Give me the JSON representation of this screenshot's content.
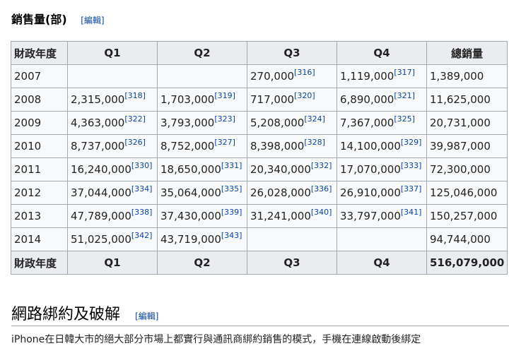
{
  "section_title": "銷售量(部)",
  "edit_label": "編輯",
  "table": {
    "headers": [
      "財政年度",
      "Q1",
      "Q2",
      "Q3",
      "Q4",
      "總銷量"
    ],
    "rows": [
      {
        "year": "2007",
        "q": [
          [
            "",
            ""
          ],
          [
            "",
            ""
          ],
          [
            "270,000",
            "[316]"
          ],
          [
            "1,119,000",
            "[317]"
          ]
        ],
        "total": "1,389,000"
      },
      {
        "year": "2008",
        "q": [
          [
            "2,315,000",
            "[318]"
          ],
          [
            "1,703,000",
            "[319]"
          ],
          [
            "717,000",
            "[320]"
          ],
          [
            "6,890,000",
            "[321]"
          ]
        ],
        "total": "11,625,000"
      },
      {
        "year": "2009",
        "q": [
          [
            "4,363,000",
            "[322]"
          ],
          [
            "3,793,000",
            "[323]"
          ],
          [
            "5,208,000",
            "[324]"
          ],
          [
            "7,367,000",
            "[325]"
          ]
        ],
        "total": "20,731,000"
      },
      {
        "year": "2010",
        "q": [
          [
            "8,737,000",
            "[326]"
          ],
          [
            "8,752,000",
            "[327]"
          ],
          [
            "8,398,000",
            "[328]"
          ],
          [
            "14,100,000",
            "[329]"
          ]
        ],
        "total": "39,987,000"
      },
      {
        "year": "2011",
        "q": [
          [
            "16,240,000",
            "[330]"
          ],
          [
            "18,650,000",
            "[331]"
          ],
          [
            "20,340,000",
            "[332]"
          ],
          [
            "17,070,000",
            "[333]"
          ]
        ],
        "total": "72,300,000"
      },
      {
        "year": "2012",
        "q": [
          [
            "37,044,000",
            "[334]"
          ],
          [
            "35,064,000",
            "[335]"
          ],
          [
            "26,028,000",
            "[336]"
          ],
          [
            "26,910,000",
            "[337]"
          ]
        ],
        "total": "125,046,000"
      },
      {
        "year": "2013",
        "q": [
          [
            "47,789,000",
            "[338]"
          ],
          [
            "37,430,000",
            "[339]"
          ],
          [
            "31,241,000",
            "[340]"
          ],
          [
            "33,797,000",
            "[341]"
          ]
        ],
        "total": "150,257,000"
      },
      {
        "year": "2014",
        "q": [
          [
            "51,025,000",
            "[342]"
          ],
          [
            "43,719,000",
            "[343]"
          ],
          [
            "",
            ""
          ],
          [
            "",
            ""
          ]
        ],
        "total": "94,744,000"
      }
    ],
    "footer": [
      "財政年度",
      "Q1",
      "Q2",
      "Q3",
      "Q4",
      "516,079,000"
    ]
  },
  "section2_title": "網路綁約及破解",
  "paragraph_start": "iPhone在日韓大市的絕大部分市場上都實行與通訊商綁約銷售的模式，手機在連線啟動後綁定"
}
